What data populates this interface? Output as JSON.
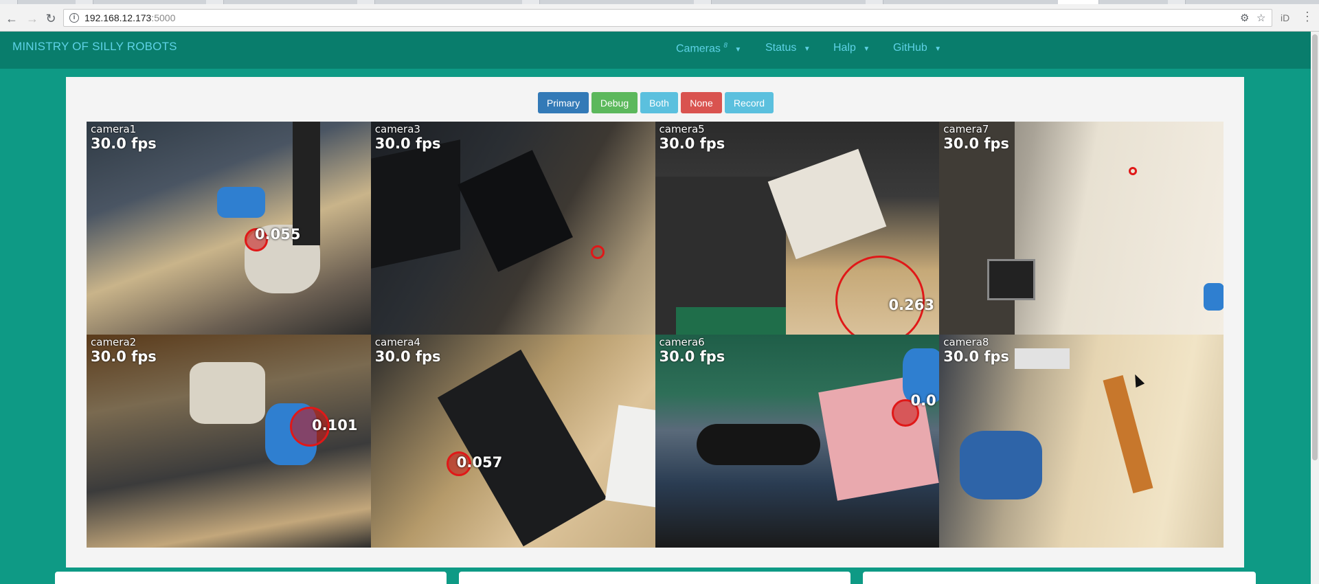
{
  "browser": {
    "url_host": "192.168.12.173",
    "url_port": ":5000",
    "back_icon": "arrow-left-icon",
    "forward_icon": "arrow-right-icon",
    "reload_icon": "reload-icon"
  },
  "navbar": {
    "brand": "MINISTRY OF SILLY ROBOTS",
    "items": [
      {
        "label": "Cameras",
        "sup": "8"
      },
      {
        "label": "Status",
        "sup": ""
      },
      {
        "label": "Halp",
        "sup": ""
      },
      {
        "label": "GitHub",
        "sup": ""
      }
    ]
  },
  "buttons": [
    {
      "label": "Primary",
      "color": "#337ab7"
    },
    {
      "label": "Debug",
      "color": "#5cb85c"
    },
    {
      "label": "Both",
      "color": "#5bc0de"
    },
    {
      "label": "None",
      "color": "#d9534f"
    },
    {
      "label": "Record",
      "color": "#5bc0de"
    }
  ],
  "cameras": [
    {
      "name": "camera1",
      "fps": "30.0 fps",
      "detection": "0.055"
    },
    {
      "name": "camera3",
      "fps": "30.0 fps",
      "detection": ""
    },
    {
      "name": "camera5",
      "fps": "30.0 fps",
      "detection": "0.263"
    },
    {
      "name": "camera7",
      "fps": "30.0 fps",
      "detection": ""
    },
    {
      "name": "camera2",
      "fps": "30.0 fps",
      "detection": "0.101"
    },
    {
      "name": "camera4",
      "fps": "30.0 fps",
      "detection": "0.057"
    },
    {
      "name": "camera6",
      "fps": "30.0 fps",
      "detection": "0.0"
    },
    {
      "name": "camera8",
      "fps": "30.0 fps",
      "detection": ""
    }
  ],
  "colors": {
    "page_bg": "#0e9a85",
    "navbar_bg": "#097d6c",
    "nav_text": "#5ed2e6",
    "detection": "#e01818"
  }
}
